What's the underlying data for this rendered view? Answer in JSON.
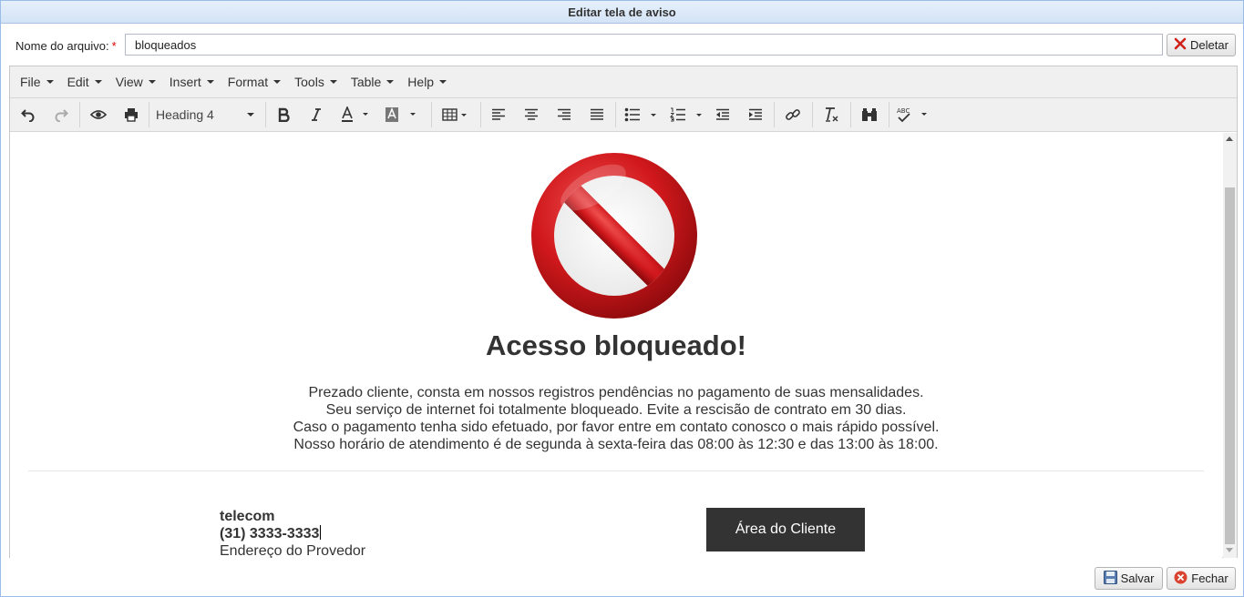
{
  "window": {
    "title": "Editar tela de aviso"
  },
  "file": {
    "label": "Nome do arquivo:",
    "required_mark": "*",
    "value": "bloqueados"
  },
  "buttons": {
    "delete": "Deletar",
    "save": "Salvar",
    "close": "Fechar"
  },
  "menubar": {
    "items": [
      "File",
      "Edit",
      "View",
      "Insert",
      "Format",
      "Tools",
      "Table",
      "Help"
    ]
  },
  "toolbar": {
    "block_format": "Heading 4"
  },
  "content": {
    "heading": "Acesso bloqueado!",
    "paragraph": [
      "Prezado cliente, consta em nossos registros pendências no pagamento de suas mensalidades.",
      "Seu serviço de internet foi totalmente bloqueado. Evite a rescisão de contrato em 30 dias.",
      "Caso o pagamento tenha sido efetuado, por favor entre em contato conosco o mais rápido possível.",
      "Nosso horário de atendimento é de segunda à sexta-feira das 08:00 às 12:30 e das 13:00 às 18:00."
    ],
    "contact": {
      "company": "telecom",
      "phone": "(31) 3333-3333",
      "address": "Endereço do Provedor"
    },
    "client_button": "Área do Cliente"
  },
  "colors": {
    "stop_red": "#cc1418",
    "dark_button": "#333333",
    "title_bar": "#dce8f7"
  }
}
